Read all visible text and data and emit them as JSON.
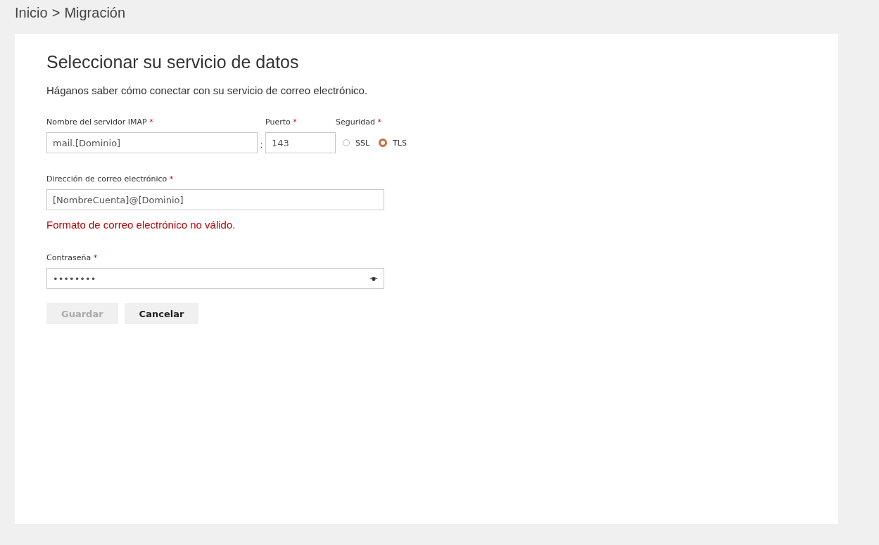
{
  "breadcrumb": [
    "Inicio",
    ">",
    "Migración"
  ],
  "title": "Seleccionar su servicio de datos",
  "subtitle": "Háganos saber cómo conectar con su servicio de correo electrónico.",
  "server": {
    "label": "Nombre del servidor IMAP",
    "required_mark": "*",
    "value": "mail.[Dominio]",
    "separator": ":"
  },
  "port": {
    "label": "Puerto",
    "required_mark": "*",
    "value": "143"
  },
  "security": {
    "label": "Seguridad",
    "required_mark": "*",
    "options": [
      {
        "label": "SSL",
        "selected": false
      },
      {
        "label": "TLS",
        "selected": true
      }
    ]
  },
  "email": {
    "label": "Dirección de correo electrónico",
    "required_mark": "*",
    "value": "[NombreCuenta]@[Dominio]",
    "error": "Formato de correo electrónico no válido."
  },
  "password": {
    "label": "Contraseña",
    "required_mark": "*",
    "value": "••••••••"
  },
  "buttons": [
    {
      "label": "Guardar",
      "disabled": true
    },
    {
      "label": "Cancelar",
      "disabled": false
    }
  ]
}
